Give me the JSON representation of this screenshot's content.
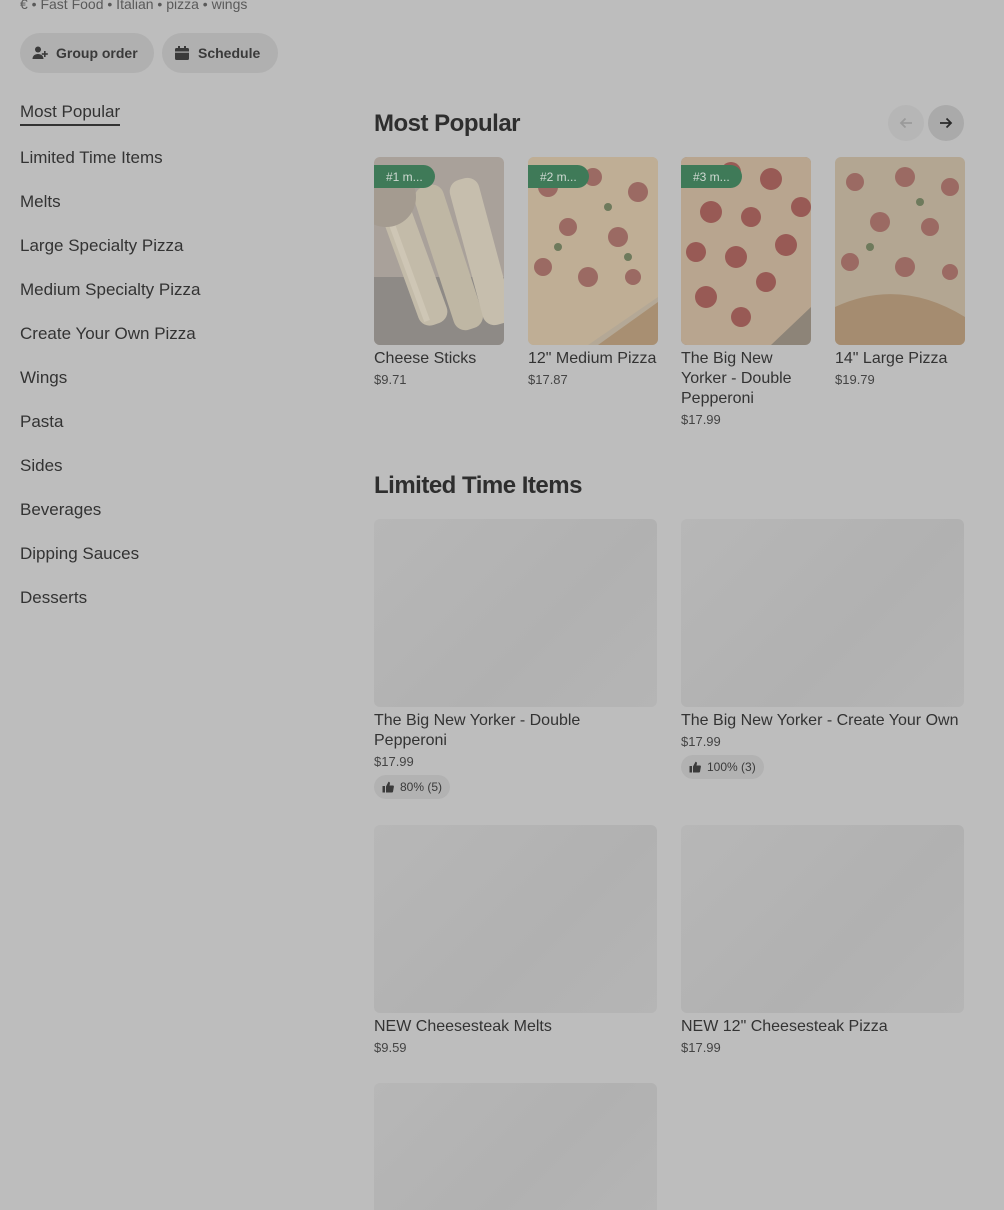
{
  "header": {
    "subtitle": "€ • Fast Food • Italian • pizza • wings",
    "group_order_label": "Group order",
    "schedule_label": "Schedule"
  },
  "sidebar": {
    "items": [
      {
        "label": "Most Popular",
        "active": true
      },
      {
        "label": "Limited Time Items"
      },
      {
        "label": "Melts"
      },
      {
        "label": "Large Specialty Pizza"
      },
      {
        "label": "Medium Specialty Pizza"
      },
      {
        "label": "Create Your Own Pizza"
      },
      {
        "label": "Wings"
      },
      {
        "label": "Pasta"
      },
      {
        "label": "Sides"
      },
      {
        "label": "Beverages"
      },
      {
        "label": "Dipping Sauces"
      },
      {
        "label": "Desserts"
      }
    ]
  },
  "most_popular": {
    "title": "Most Popular",
    "items": [
      {
        "rank": "#1 m...",
        "name": "Cheese Sticks",
        "price": "$9.71",
        "image": "cheese-sticks"
      },
      {
        "rank": "#2 m...",
        "name": "12\" Medium Pizza",
        "price": "$17.87",
        "image": "pizza-supreme"
      },
      {
        "rank": "#3 m...",
        "name": "The Big New Yorker - Double Pepperoni",
        "price": "$17.99",
        "image": "pizza-pepperoni"
      },
      {
        "name": "14\" Large Pizza",
        "price": "$19.79",
        "image": "pizza-supreme"
      }
    ]
  },
  "limited_time": {
    "title": "Limited Time Items",
    "items": [
      {
        "name": "The Big New Yorker - Double Pepperoni",
        "price": "$17.99",
        "rating": "80% (5)"
      },
      {
        "name": "The Big New Yorker - Create Your Own",
        "price": "$17.99",
        "rating": "100% (3)"
      },
      {
        "name": "NEW Cheesesteak Melts",
        "price": "$9.59"
      },
      {
        "name": "NEW 12\" Cheesesteak Pizza",
        "price": "$17.99"
      },
      {
        "name": "",
        "price": ""
      }
    ]
  },
  "colors": {
    "background": "#bdbdbd",
    "rank_badge": "#3f7a58"
  }
}
